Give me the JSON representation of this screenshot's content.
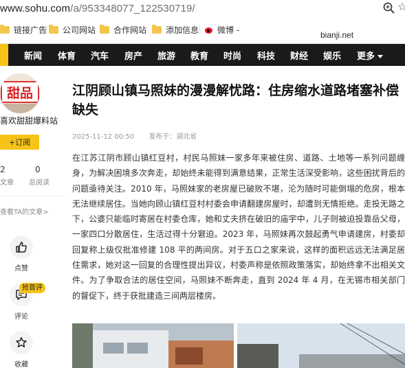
{
  "browser": {
    "url_host": "www.sohu.com",
    "url_path": "/a/953348077_122530719/"
  },
  "bookmarks": [
    {
      "label": "链接广告",
      "icon": "folder-icon"
    },
    {
      "label": "公司网站",
      "icon": "folder-icon"
    },
    {
      "label": "合作网站",
      "icon": "folder-icon"
    },
    {
      "label": "添加信息",
      "icon": "folder-icon"
    },
    {
      "label": "微博 -",
      "icon": "weibo-icon"
    }
  ],
  "watermark": "bianji.net",
  "nav": {
    "items": [
      "新闻",
      "体育",
      "汽车",
      "房产",
      "旅游",
      "教育",
      "时尚",
      "科技",
      "财经",
      "娱乐"
    ],
    "more": "更多"
  },
  "author": {
    "name": "喜欢甜甜爆料站",
    "avatar_text": "甜品",
    "follow": "+订阅",
    "stats": [
      {
        "value": "2",
        "label": "文章"
      },
      {
        "value": "0",
        "label": "总阅读"
      }
    ],
    "view_all": "查看TA的文章>"
  },
  "actions": [
    {
      "label": "点赞",
      "icon": "thumbs-up-icon"
    },
    {
      "label": "评论",
      "icon": "comment-icon",
      "badge": "抢首评"
    },
    {
      "label": "收藏",
      "icon": "star-icon"
    }
  ],
  "article": {
    "title": "江阴顾山镇马照妹的漫漫解忧路：住房缩水道路堵塞补偿缺失",
    "date": "2025-11-12 00:50",
    "source": "发布于：湖北省",
    "body": "在江苏江阴市顾山镇红豆村，村民马照妹一家多年来被住房、道路、土地等一系列问题缠身，为解决困境多次奔走，却始终未能得到满意结果，正常生活深受影响，这些困扰背后的问题亟待关注。2010 年，马照妹家的老房屋已破败不堪，沦为随时可能倒塌的危房，根本无法继续居住。当她向顾山镇红豆村村委会申请翻建房屋时，却遭到无情拒绝。走投无路之下，公婆只能临时寄居在村委仓库，她和丈夫挤在破旧的庙宇中，儿子则被迫投靠岳父母，一家四口分散居住，生活过得十分窘迫。2023 年，马照妹再次鼓起勇气申请建房，村委却回复称上级仅批准修建 108 平的两间房。对于五口之家来说，这样的面积远远无法满足居住需求，她对这一回复的合理性提出异议，村委声称是依照政策落实，却始终拿不出相关文件。为了争取合法的居住空间，马照妹不断奔走，直到 2024 年 4 月，在无锡市相关部门的督促下，终于获批建造三间两层楼房。"
  },
  "colors": {
    "accent": "#f7c318",
    "nav_bg": "#1a1a1a"
  }
}
